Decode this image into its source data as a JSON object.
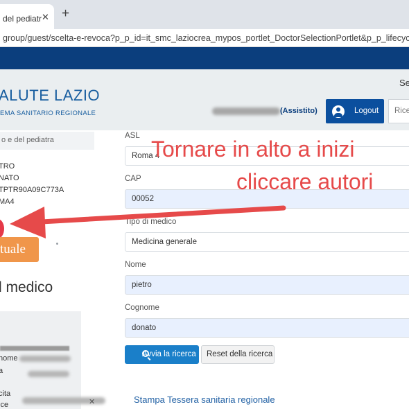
{
  "browser": {
    "tab_title": "del pediatra",
    "tab_close": "✕",
    "new_tab": "+",
    "url": "group/guest/scelta-e-revoca?p_p_id=it_smc_laziocrea_mypos_portlet_DoctorSelectionPortlet&p_p_lifecycle="
  },
  "header": {
    "brand_title": "ALUTE LAZIO",
    "brand_subtitle": "EMA SANITARIO REGIONALE",
    "right_partial": "Se",
    "assistito": "(Assistito)",
    "logout_label": "Logout",
    "search_placeholder": "Rice"
  },
  "left": {
    "nav_label": "o e del pediatra",
    "info_lines": [
      "TRO",
      "NATO",
      "TPTR90A09C773A",
      "MA4"
    ],
    "action_button": "tuale",
    "section_heading": "l medico",
    "box_lines": [
      "nome",
      "a",
      "cita",
      "ice"
    ]
  },
  "form": {
    "asl": {
      "label": "ASL",
      "value": "Roma 4"
    },
    "cap": {
      "label": "CAP",
      "value": "00052"
    },
    "tipo": {
      "label": "Tipo di medico",
      "value": "Medicina generale"
    },
    "nome": {
      "label": "Nome",
      "value": "pietro"
    },
    "cognome": {
      "label": "Cognome",
      "value": "donato"
    },
    "search_button": "Avvia la ricerca",
    "reset_button": "Reset della ricerca",
    "print_link": "Stampa Tessera sanitaria regionale"
  },
  "annotation": {
    "line1": "Tornare in alto a inizi",
    "line2": "cliccare autori",
    "color": "#e64a4a"
  },
  "colors": {
    "brand_blue": "#0b3e7d",
    "logout_blue": "#0b4f9e",
    "search_button": "#1a7fc9",
    "orange_button": "#f0964a"
  }
}
